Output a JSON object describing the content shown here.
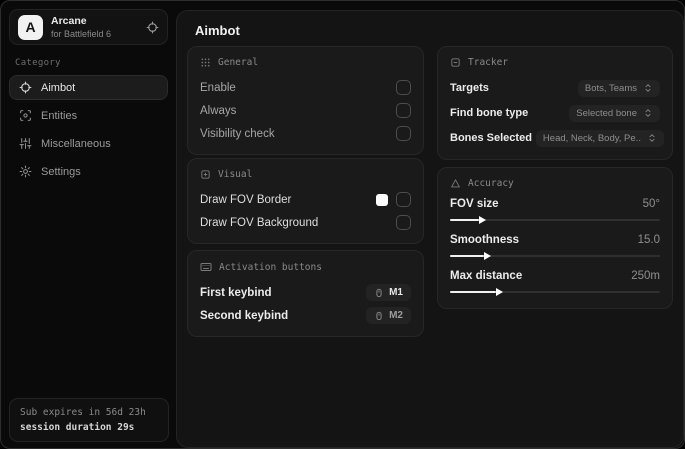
{
  "sidebar": {
    "brand": {
      "initial": "A",
      "title": "Arcane",
      "subtitle": "for Battlefield 6"
    },
    "category_label": "Category",
    "items": [
      {
        "label": "Aimbot",
        "icon": "crosshair-icon",
        "active": true
      },
      {
        "label": "Entities",
        "icon": "scan-icon",
        "active": false
      },
      {
        "label": "Miscellaneous",
        "icon": "sliders-icon",
        "active": false
      },
      {
        "label": "Settings",
        "icon": "gear-icon",
        "active": false
      }
    ],
    "footer": {
      "expiry": "Sub expires in 56d 23h",
      "session": "session duration 29s"
    }
  },
  "main": {
    "title": "Aimbot",
    "general": {
      "title": "General",
      "rows": [
        {
          "label": "Enable",
          "checked": false
        },
        {
          "label": "Always",
          "checked": false
        },
        {
          "label": "Visibility check",
          "checked": false
        }
      ]
    },
    "visual": {
      "title": "Visual",
      "rows": [
        {
          "label": "Draw FOV Border",
          "swatch_color": "#ffffff",
          "checked": false
        },
        {
          "label": "Draw FOV Background",
          "checked": false
        }
      ]
    },
    "activation": {
      "title": "Activation buttons",
      "rows": [
        {
          "label": "First keybind",
          "key": "M1"
        },
        {
          "label": "Second keybind",
          "key": "M2"
        }
      ]
    },
    "tracker": {
      "title": "Tracker",
      "rows": [
        {
          "label": "Targets",
          "value": "Bots, Teams"
        },
        {
          "label": "Find bone type",
          "value": "Selected bone"
        },
        {
          "label": "Bones Selected",
          "value": "Head, Neck, Body, Pe.."
        }
      ]
    },
    "accuracy": {
      "title": "Accuracy",
      "rows": [
        {
          "label": "FOV size",
          "value": "50°",
          "percent": 14
        },
        {
          "label": "Smoothness",
          "value": "15.0",
          "percent": 16
        },
        {
          "label": "Max distance",
          "value": "250m",
          "percent": 22
        }
      ]
    }
  },
  "colors": {
    "accent": "#ffffff",
    "panel_bg": "#141414",
    "card_bg": "#1a1a1a",
    "window_bg": "#0a0a0a"
  }
}
